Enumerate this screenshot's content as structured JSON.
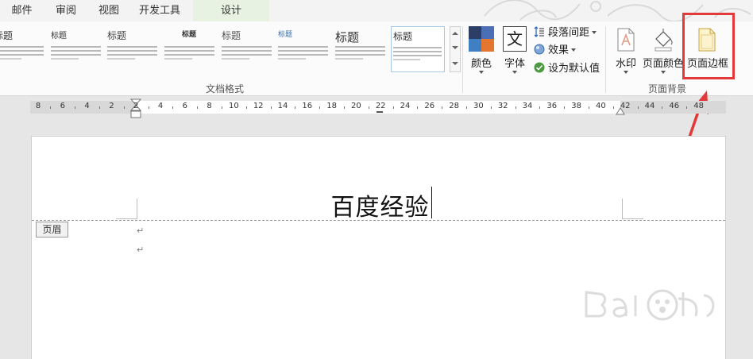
{
  "menu": {
    "tabs": [
      {
        "label": "邮件"
      },
      {
        "label": "审阅"
      },
      {
        "label": "视图"
      },
      {
        "label": "开发工具"
      },
      {
        "label": "设计"
      }
    ]
  },
  "ribbon": {
    "gallery": {
      "thumbs": [
        {
          "title": "标题"
        },
        {
          "title": "标题"
        },
        {
          "title": "标题"
        },
        {
          "title": "标题"
        },
        {
          "title": "标题"
        },
        {
          "title": "标题"
        },
        {
          "title": "标题"
        },
        {
          "title": "标题"
        }
      ],
      "group_label": "文档格式"
    },
    "colors_label": "颜色",
    "fonts_label": "字体",
    "paragraph_spacing_label": "段落间距",
    "effects_label": "效果",
    "set_default_label": "设为默认值",
    "watermark_label": "水印",
    "page_color_label": "页面颜色",
    "page_border_label": "页面边框",
    "page_background_label": "页面背景"
  },
  "ruler": {
    "labels": [
      "8",
      "6",
      "4",
      "2",
      "2",
      "4",
      "6",
      "8",
      "10",
      "12",
      "14",
      "16",
      "18",
      "20",
      "22",
      "24",
      "26",
      "28",
      "30",
      "32",
      "34",
      "36",
      "38",
      "40",
      "42",
      "44",
      "46",
      "48"
    ]
  },
  "document": {
    "header_text": "百度经验",
    "header_tag": "页眉",
    "para_mark": "↵"
  },
  "colors": {
    "highlight": "#e23a3a",
    "accent": "#1f5fa8"
  }
}
